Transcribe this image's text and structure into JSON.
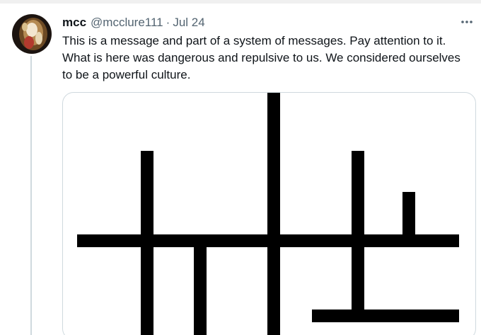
{
  "tweet": {
    "author_name": "mcc",
    "author_handle": "@mcclure111",
    "separator": "·",
    "date": "Jul 24",
    "text": "This is a message and part of a system of messages. Pay attention to it.\nWhat is here was dangerous and repulsive to us. We considered ourselves\nto be a powerful culture.",
    "more_icon": "more-horizontal-icon"
  },
  "colors": {
    "name": "#0f1419",
    "secondary": "#536471",
    "border": "#cfd9de",
    "glyph": "#000000"
  }
}
